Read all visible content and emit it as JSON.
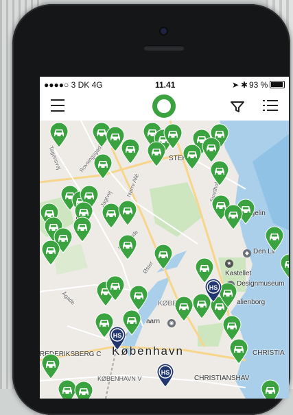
{
  "status_bar": {
    "carrier": "●●●●○ 3 DK  4G",
    "time": "11.41",
    "battery": "93 %"
  },
  "app_bar": {
    "menu_icon": "hamburger-menu-icon",
    "logo_icon": "green-ring-logo",
    "filter_icon": "filter-funnel-icon",
    "list_icon": "list-view-icon"
  },
  "map": {
    "labels": {
      "kobenhavn": "København",
      "kobenhavn_v": "KØBENHAVN V",
      "christianshavn": "CHRISTIANSHAV",
      "christia": "CHRISTIA",
      "frederiksberg": "REDERIKSBERG C",
      "designmuseum": "Designmuseum",
      "kastellet": "Kastellet",
      "amalienborg": "alienborg",
      "den_lille": "Den Lil",
      "langelinie": "Langelin",
      "osterbro": "STERBR",
      "no": "N",
      "rosenborg": "KØBE",
      "raadhus": "aarn",
      "tagensvej": "Tagensvej",
      "rovsingsgade": "Rovsingsgade",
      "jagtvej": "Jagtvej",
      "mollegade": "Møllegade",
      "agade": "Ågade",
      "oster": "Øster",
      "norre_alle": "Nørre Allé",
      "nordhavn": "Sundholmsvej"
    },
    "colors": {
      "car_pin": "#3aa23f",
      "hs_pin": "#223670",
      "water": "#a9cfea",
      "park": "#cde6bf"
    }
  }
}
